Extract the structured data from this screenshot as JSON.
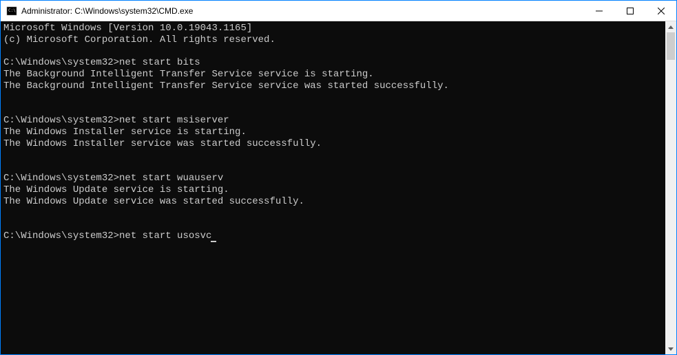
{
  "titlebar": {
    "title": "Administrator: C:\\Windows\\system32\\CMD.exe"
  },
  "terminal": {
    "header1": "Microsoft Windows [Version 10.0.19043.1165]",
    "header2": "(c) Microsoft Corporation. All rights reserved.",
    "prompt": "C:\\Windows\\system32>",
    "cmd1": "net start bits",
    "out1a": "The Background Intelligent Transfer Service service is starting.",
    "out1b": "The Background Intelligent Transfer Service service was started successfully.",
    "cmd2": "net start msiserver",
    "out2a": "The Windows Installer service is starting.",
    "out2b": "The Windows Installer service was started successfully.",
    "cmd3": "net start wuauserv",
    "out3a": "The Windows Update service is starting.",
    "out3b": "The Windows Update service was started successfully.",
    "cmd4": "net start usosvc"
  }
}
